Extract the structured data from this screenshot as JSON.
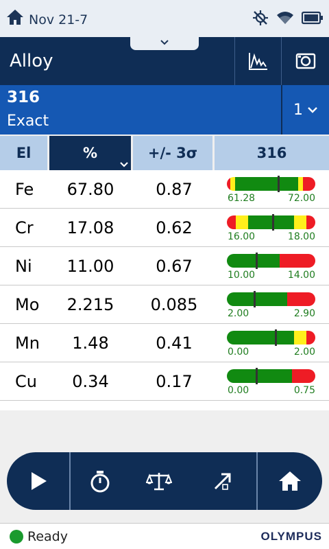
{
  "status_bar": {
    "date": "Nov 21-7"
  },
  "mode_bar": {
    "title": "Alloy"
  },
  "result": {
    "name": "316",
    "match": "Exact",
    "selector": "1"
  },
  "table": {
    "headers": {
      "element": "El",
      "percent": "%",
      "error": "+/- 3σ",
      "grade": "316"
    },
    "rows": [
      {
        "el": "Fe",
        "pct": "67.80",
        "err": "0.87",
        "min": "61.28",
        "max": "72.00",
        "marker": 0.58,
        "bands": [
          [
            "red",
            0.04
          ],
          [
            "yellow",
            0.05
          ],
          [
            "green",
            0.72
          ],
          [
            "yellow",
            0.05
          ],
          [
            "red",
            0.14
          ]
        ]
      },
      {
        "el": "Cr",
        "pct": "17.08",
        "err": "0.62",
        "min": "16.00",
        "max": "18.00",
        "marker": 0.52,
        "bands": [
          [
            "red",
            0.1
          ],
          [
            "yellow",
            0.14
          ],
          [
            "green",
            0.52
          ],
          [
            "yellow",
            0.14
          ],
          [
            "red",
            0.1
          ]
        ]
      },
      {
        "el": "Ni",
        "pct": "11.00",
        "err": "0.67",
        "min": "10.00",
        "max": "14.00",
        "marker": 0.33,
        "bands": [
          [
            "green",
            0.6
          ],
          [
            "red",
            0.4
          ]
        ]
      },
      {
        "el": "Mo",
        "pct": "2.215",
        "err": "0.085",
        "min": "2.00",
        "max": "2.90",
        "marker": 0.31,
        "bands": [
          [
            "green",
            0.68
          ],
          [
            "red",
            0.32
          ]
        ]
      },
      {
        "el": "Mn",
        "pct": "1.48",
        "err": "0.41",
        "min": "0.00",
        "max": "2.00",
        "marker": 0.55,
        "bands": [
          [
            "green",
            0.76
          ],
          [
            "yellow",
            0.14
          ],
          [
            "red",
            0.1
          ]
        ]
      },
      {
        "el": "Cu",
        "pct": "0.34",
        "err": "0.17",
        "min": "0.00",
        "max": "0.75",
        "marker": 0.33,
        "bands": [
          [
            "green",
            0.74
          ],
          [
            "red",
            0.26
          ]
        ]
      }
    ]
  },
  "footer": {
    "status": "Ready",
    "brand": "OLYMPUS"
  },
  "icons": {
    "status": [
      "home-icon",
      "gps-off-icon",
      "wifi-icon",
      "battery-icon"
    ],
    "mode": [
      "spectrum-icon",
      "camera-icon"
    ],
    "toolbar": [
      "play-icon",
      "timer-icon",
      "scale-icon",
      "export-icon",
      "home-icon"
    ]
  },
  "colors": {
    "navy": "#0f2d55",
    "blue": "#1558b3",
    "header_light": "#b5cde8",
    "red": "#ee1c25",
    "yellow": "#ffef1c",
    "green": "#118a11",
    "ready": "#1a9a2e"
  }
}
